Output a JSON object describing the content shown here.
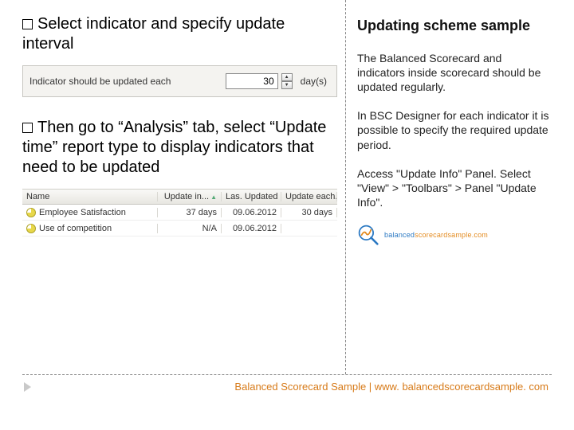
{
  "left": {
    "instr1": "Select indicator and specify update interval",
    "instr2": "Then go to “Analysis” tab, select “Update time” report type to display indicators that need to be updated",
    "shot1": {
      "label": "Indicator should be updated each",
      "value": "30",
      "unit": "day(s)"
    },
    "shot2": {
      "headers": {
        "name": "Name",
        "upd": "Update in...",
        "last": "Las. Updated",
        "each": "Update each..."
      },
      "rows": [
        {
          "name": "Employee Satisfaction",
          "upd": "37 days",
          "last": "09.06.2012",
          "each": "30 days"
        },
        {
          "name": "Use of competition",
          "upd": "N/A",
          "last": "09.06.2012",
          "each": ""
        }
      ]
    }
  },
  "right": {
    "title": "Updating scheme sample",
    "p1": "The Balanced Scorecard and indicators inside scorecard should be updated regularly.",
    "p2": "In BSC Designer for each indicator it is possible to specify the required update period.",
    "p3": "Access \"Update Info\" Panel. Select \"View\" > \"Toolbars\" > Panel \"Update Info\".",
    "logo_text1": "balanced",
    "logo_text2": "scorecardsample.com"
  },
  "footer": "Balanced Scorecard Sample | www. balancedscorecardsample. com"
}
